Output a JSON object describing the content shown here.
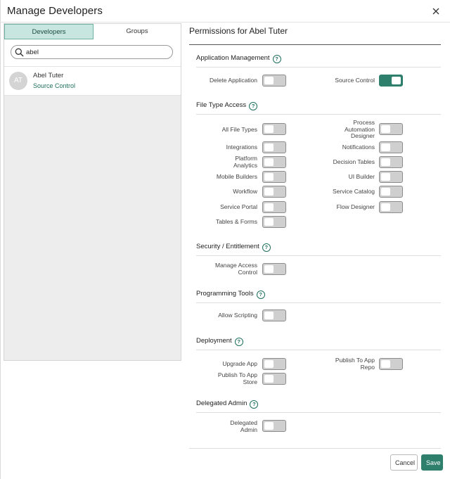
{
  "dialog": {
    "title": "Manage Developers"
  },
  "left": {
    "tabs": [
      "Developers",
      "Groups"
    ],
    "search_value": "abel",
    "developer": {
      "initials": "AT",
      "name": "Abel Tuter",
      "role": "Source Control"
    }
  },
  "permissions": {
    "title": "Permissions for Abel Tuter",
    "sections": {
      "app_mgmt": {
        "title": "Application Management",
        "items": {
          "delete_application": "Delete Application",
          "source_control": "Source Control"
        }
      },
      "file_type": {
        "title": "File Type Access",
        "items": {
          "all_file_types": "All File Types",
          "process_automation_designer": "Process Automation Designer",
          "integrations": "Integrations",
          "notifications": "Notifications",
          "platform_analytics": "Platform Analytics",
          "decision_tables": "Decision Tables",
          "mobile_builders": "Mobile Builders",
          "ui_builder": "UI Builder",
          "workflow": "Workflow",
          "service_catalog": "Service Catalog",
          "service_portal": "Service Portal",
          "flow_designer": "Flow Designer",
          "tables_forms": "Tables & Forms"
        }
      },
      "security": {
        "title": "Security / Entitlement",
        "items": {
          "manage_access_control": "Manage Access Control"
        }
      },
      "programming": {
        "title": "Programming Tools",
        "items": {
          "allow_scripting": "Allow Scripting"
        }
      },
      "deployment": {
        "title": "Deployment",
        "items": {
          "upgrade_app": "Upgrade App",
          "publish_to_app_repo": "Publish To App Repo",
          "publish_to_app_store": "Publish To App Store"
        }
      },
      "delegated": {
        "title": "Delegated Admin",
        "items": {
          "delegated_admin": "Delegated Admin"
        }
      }
    },
    "toggles_on": [
      "source_control"
    ]
  },
  "footer": {
    "cancel": "Cancel",
    "save": "Save"
  },
  "colors": {
    "accent": "#2f7f6d",
    "tab_active_bg": "#c7e6df",
    "toggle_off": "#cfcfcf"
  },
  "icons": {
    "close": "close-icon",
    "search": "search-icon",
    "help": "help-icon"
  }
}
